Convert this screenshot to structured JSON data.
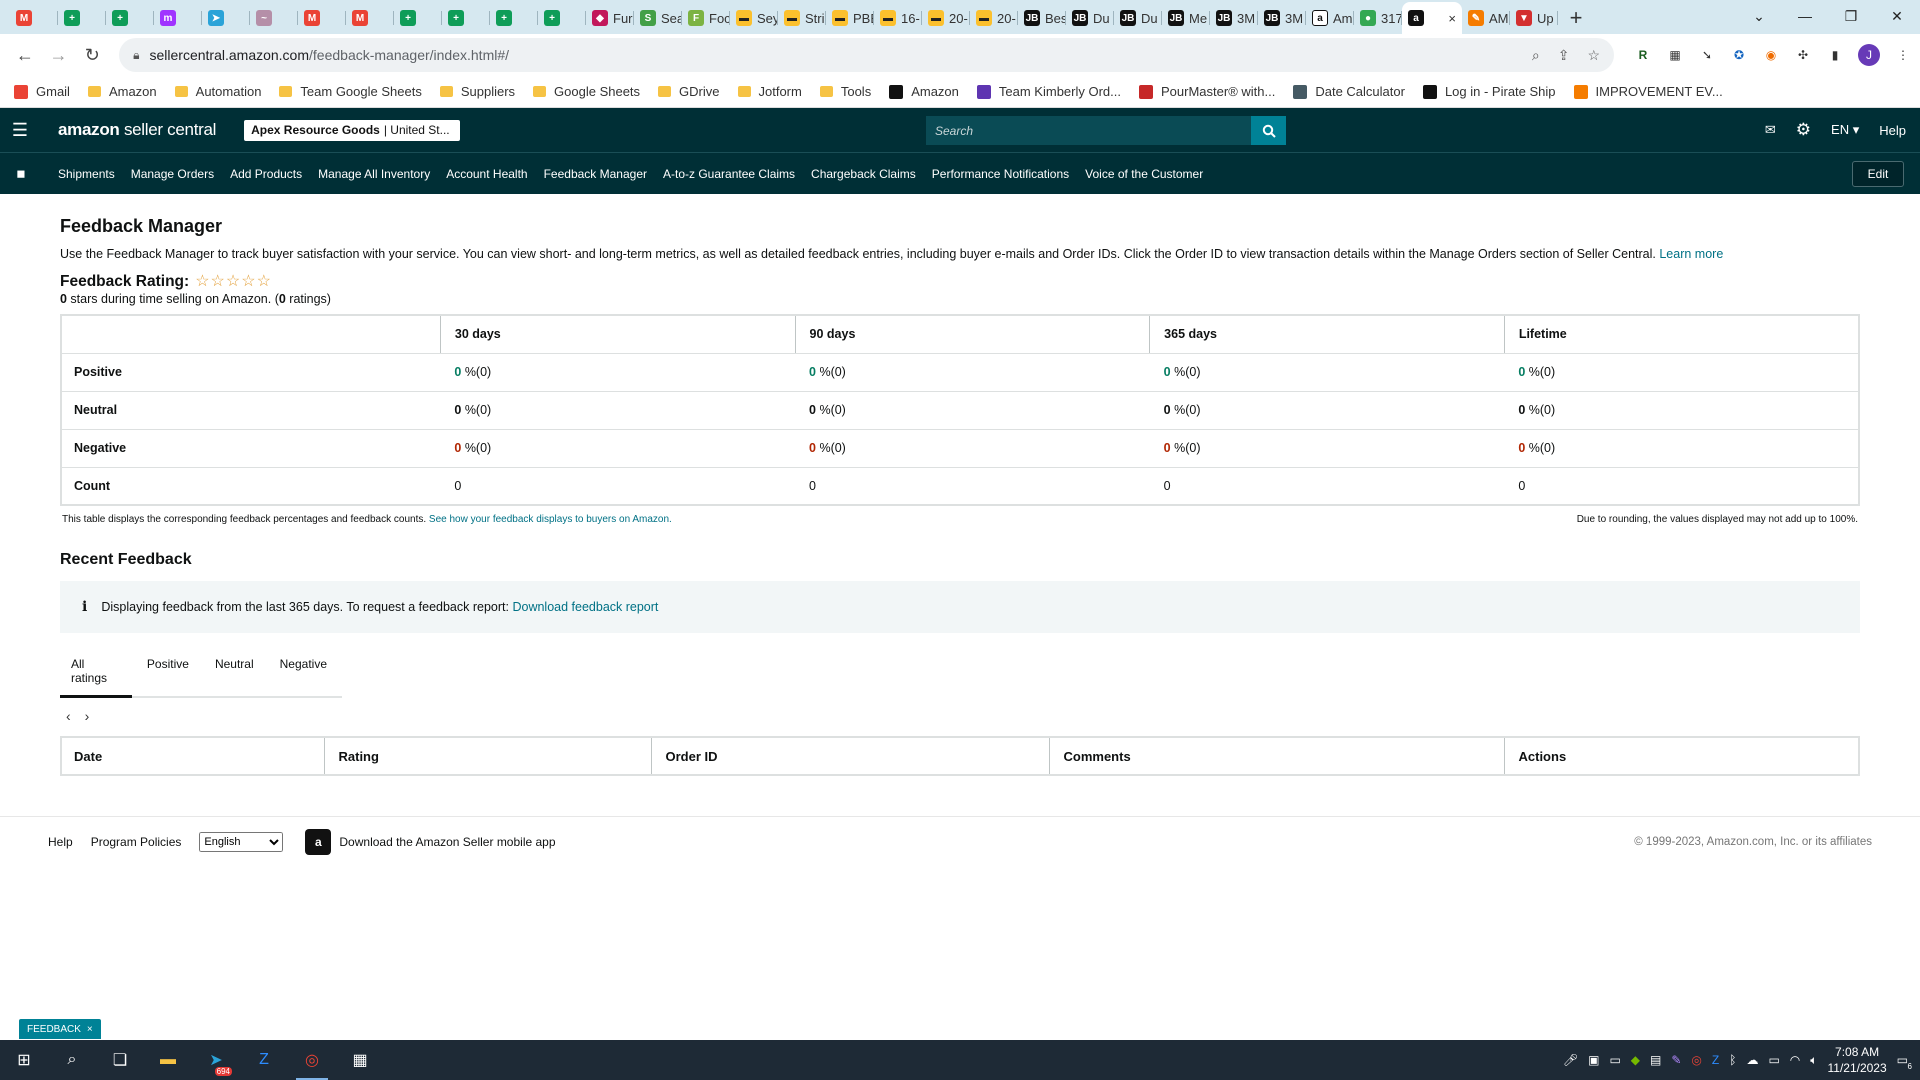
{
  "browser": {
    "tabs": [
      {
        "icon": "gmail-icon",
        "color": "#ea4335",
        "glyph": "M",
        "label": ""
      },
      {
        "icon": "sheets-icon",
        "color": "#0f9d58",
        "glyph": "+",
        "label": ""
      },
      {
        "icon": "sheets-icon",
        "color": "#0f9d58",
        "glyph": "+",
        "label": ""
      },
      {
        "icon": "messenger-icon",
        "color": "#a033ff",
        "glyph": "m",
        "label": ""
      },
      {
        "icon": "telegram-icon",
        "color": "#2aa3d8",
        "glyph": "➤",
        "label": ""
      },
      {
        "icon": "script-icon",
        "color": "#b58fa8",
        "glyph": "~",
        "label": ""
      },
      {
        "icon": "gmail-icon",
        "color": "#ea4335",
        "glyph": "M",
        "label": ""
      },
      {
        "icon": "gmail-icon",
        "color": "#ea4335",
        "glyph": "M",
        "label": ""
      },
      {
        "icon": "sheets-icon",
        "color": "#0f9d58",
        "glyph": "+",
        "label": ""
      },
      {
        "icon": "sheets-icon",
        "color": "#0f9d58",
        "glyph": "+",
        "label": ""
      },
      {
        "icon": "sheets-icon",
        "color": "#0f9d58",
        "glyph": "+",
        "label": ""
      },
      {
        "icon": "sheets-icon",
        "color": "#0f9d58",
        "glyph": "+",
        "label": ""
      },
      {
        "icon": "fun-icon",
        "color": "#c2185b",
        "glyph": "◆",
        "label": "Fur"
      },
      {
        "icon": "seal-icon",
        "color": "#43a047",
        "glyph": "S",
        "label": "Sea"
      },
      {
        "icon": "food-icon",
        "color": "#7cb342",
        "glyph": "F",
        "label": "Foc"
      },
      {
        "icon": "sey-icon",
        "color": "#fbc02d",
        "glyph": "▬",
        "label": "Sey"
      },
      {
        "icon": "stri-icon",
        "color": "#fbc02d",
        "glyph": "▬",
        "label": "Stri"
      },
      {
        "icon": "pbe-icon",
        "color": "#fbc02d",
        "glyph": "▬",
        "label": "PBE"
      },
      {
        "icon": "16-icon",
        "color": "#fbc02d",
        "glyph": "▬",
        "label": "16-"
      },
      {
        "icon": "20-icon",
        "color": "#fbc02d",
        "glyph": "▬",
        "label": "20-"
      },
      {
        "icon": "20-icon",
        "color": "#fbc02d",
        "glyph": "▬",
        "label": "20-"
      },
      {
        "icon": "jb-icon",
        "color": "#111111",
        "glyph": "JB",
        "label": "Bes"
      },
      {
        "icon": "jb-icon",
        "color": "#111111",
        "glyph": "JB",
        "label": "Du"
      },
      {
        "icon": "jb-icon",
        "color": "#111111",
        "glyph": "JB",
        "label": "Du"
      },
      {
        "icon": "jb-icon",
        "color": "#111111",
        "glyph": "JB",
        "label": "Me"
      },
      {
        "icon": "jb-icon",
        "color": "#111111",
        "glyph": "JB",
        "label": "3M"
      },
      {
        "icon": "jb-icon",
        "color": "#111111",
        "glyph": "JB",
        "label": "3M"
      },
      {
        "icon": "amazon-icon",
        "color": "#ffffff",
        "glyph": "a",
        "label": "Am"
      },
      {
        "icon": "maps-icon",
        "color": "#34a853",
        "glyph": "●",
        "label": "317"
      }
    ],
    "active_tab": {
      "icon": "amazon-icon",
      "glyph": "a",
      "close": "×"
    },
    "tabs_after": [
      {
        "icon": "edit-icon",
        "color": "#f57c00",
        "glyph": "✎",
        "label": "AM"
      },
      {
        "icon": "up-icon",
        "color": "#d32f2f",
        "glyph": "▼",
        "label": "Up"
      }
    ],
    "url_host": "sellercentral.amazon.com",
    "url_path": "/feedback-manager/index.html#/",
    "bookmarks": [
      {
        "label": "Gmail",
        "type": "gmail"
      },
      {
        "label": "Amazon",
        "type": "folder"
      },
      {
        "label": "Automation",
        "type": "folder"
      },
      {
        "label": "Team Google Sheets",
        "type": "folder"
      },
      {
        "label": "Suppliers",
        "type": "folder"
      },
      {
        "label": "Google Sheets",
        "type": "folder"
      },
      {
        "label": "GDrive",
        "type": "folder"
      },
      {
        "label": "Jotform",
        "type": "folder"
      },
      {
        "label": "Tools",
        "type": "folder"
      },
      {
        "label": "Amazon",
        "type": "amazon"
      },
      {
        "label": "Team Kimberly Ord...",
        "type": "form"
      },
      {
        "label": "PourMaster® with...",
        "type": "pour"
      },
      {
        "label": "Date Calculator",
        "type": "calc"
      },
      {
        "label": "Log in - Pirate Ship",
        "type": "pirate"
      },
      {
        "label": "IMPROVEMENT EV...",
        "type": "improve"
      }
    ]
  },
  "header": {
    "logo_bold": "amazon",
    "logo_light": "seller central",
    "account_name": "Apex Resource Goods",
    "account_region": "| United St...",
    "search_placeholder": "Search",
    "language": "EN ▾",
    "help": "Help"
  },
  "subnav": {
    "links": [
      "Shipments",
      "Manage Orders",
      "Add Products",
      "Manage All Inventory",
      "Account Health",
      "Feedback Manager",
      "A-to-z Guarantee Claims",
      "Chargeback Claims",
      "Performance Notifications",
      "Voice of the Customer"
    ],
    "edit": "Edit"
  },
  "page": {
    "title": "Feedback Manager",
    "description": "Use the Feedback Manager to track buyer satisfaction with your service. You can view short- and long-term metrics, as well as detailed feedback entries, including buyer e-mails and Order IDs. Click the Order ID to view transaction details within the Manage Orders section of Seller Central.",
    "learn_more": "Learn more",
    "rating_label": "Feedback Rating:",
    "rating_stars": "☆☆☆☆☆",
    "rating_value": "0",
    "rating_sub_a": " stars during time selling on Amazon. (",
    "rating_count": "0",
    "rating_sub_b": " ratings)"
  },
  "metrics": {
    "columns": [
      "30 days",
      "90 days",
      "365 days",
      "Lifetime"
    ],
    "rows": [
      {
        "label": "Positive",
        "kind": "pos",
        "cells": [
          {
            "num": "0",
            "rest": " %(0)"
          },
          {
            "num": "0",
            "rest": " %(0)"
          },
          {
            "num": "0",
            "rest": " %(0)"
          },
          {
            "num": "0",
            "rest": " %(0)"
          }
        ]
      },
      {
        "label": "Neutral",
        "kind": "neu",
        "cells": [
          {
            "num": "0",
            "rest": " %(0)"
          },
          {
            "num": "0",
            "rest": " %(0)"
          },
          {
            "num": "0",
            "rest": " %(0)"
          },
          {
            "num": "0",
            "rest": " %(0)"
          }
        ]
      },
      {
        "label": "Negative",
        "kind": "neg",
        "cells": [
          {
            "num": "0",
            "rest": " %(0)"
          },
          {
            "num": "0",
            "rest": " %(0)"
          },
          {
            "num": "0",
            "rest": " %(0)"
          },
          {
            "num": "0",
            "rest": " %(0)"
          }
        ]
      },
      {
        "label": "Count",
        "kind": "count",
        "cells": [
          {
            "num": "",
            "rest": "0"
          },
          {
            "num": "",
            "rest": "0"
          },
          {
            "num": "",
            "rest": "0"
          },
          {
            "num": "",
            "rest": "0"
          }
        ]
      }
    ],
    "note_left": "This table displays the corresponding feedback percentages and feedback counts.",
    "note_link": "See how your feedback displays to buyers on Amazon.",
    "note_right": "Due to rounding, the values displayed may not add up to 100%."
  },
  "recent": {
    "title": "Recent Feedback",
    "alert_text": "Displaying feedback from the last 365 days. To request a feedback report:",
    "alert_link": "Download feedback report",
    "tabs": [
      "All ratings",
      "Positive",
      "Neutral",
      "Negative"
    ],
    "columns": [
      "Date",
      "Rating",
      "Order ID",
      "Comments",
      "Actions"
    ]
  },
  "footer": {
    "help": "Help",
    "policies": "Program Policies",
    "language": "English",
    "app": "Download the Amazon Seller mobile app",
    "copyright": "© 1999-2023, Amazon.com, Inc. or its affiliates",
    "feedback_badge": "FEEDBACK"
  },
  "taskbar": {
    "time": "7:08 AM",
    "date": "11/21/2023",
    "telegram_badge": "694",
    "notifications": "6"
  }
}
